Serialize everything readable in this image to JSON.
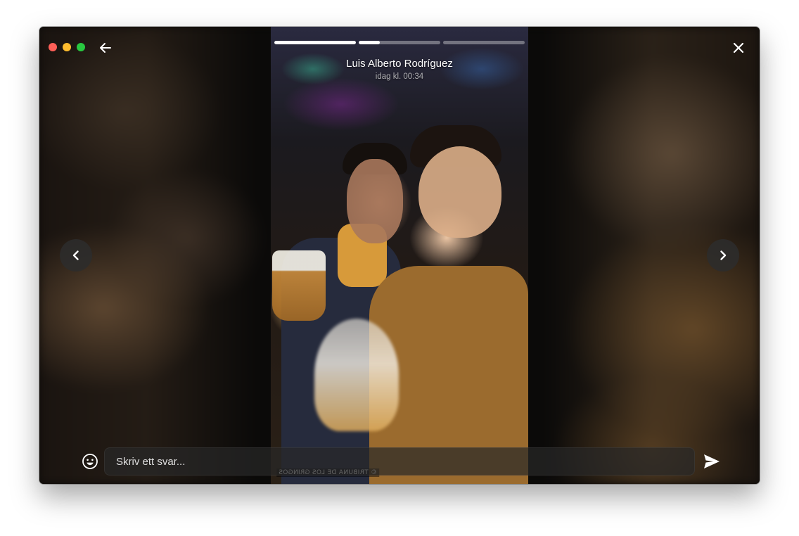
{
  "window": {
    "controls": [
      "close",
      "minimize",
      "zoom"
    ]
  },
  "story": {
    "author": "Luis Alberto Rodríguez",
    "timestamp": "idag kl. 00:34",
    "progress": [
      1.0,
      0.26,
      0.0
    ],
    "watermark": "© TRIBUNA DE LOS GRINGOS"
  },
  "icons": {
    "back": "arrow-left-icon",
    "close": "close-icon",
    "prev": "chevron-left-icon",
    "next": "chevron-right-icon",
    "emoji": "smiley-icon",
    "send": "send-icon"
  },
  "reply": {
    "placeholder": "Skriv ett svar..."
  }
}
